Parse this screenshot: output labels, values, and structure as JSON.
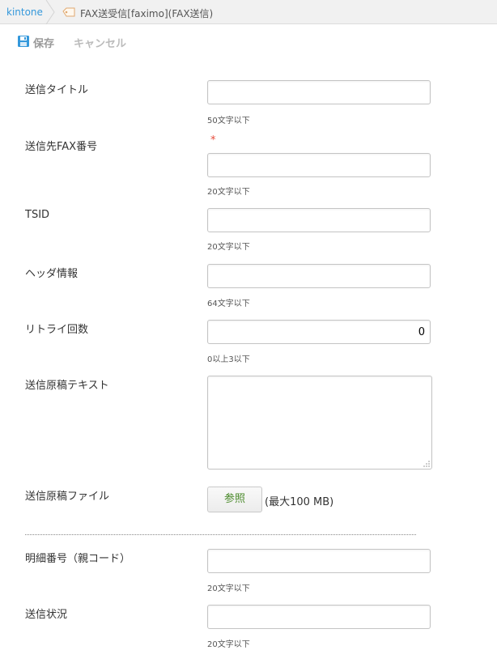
{
  "breadcrumb": {
    "home": "kintone",
    "app": "FAX送受信[faximo](FAX送信)"
  },
  "toolbar": {
    "save_label": "保存",
    "cancel_label": "キャンセル"
  },
  "fields": [
    {
      "label": "送信タイトル",
      "value": "",
      "hint": "50文字以下"
    },
    {
      "label": "送信先FAX番号",
      "value": "",
      "hint": "20文字以下",
      "required_mark": "*"
    },
    {
      "label": "TSID",
      "value": "",
      "hint": "20文字以下"
    },
    {
      "label": "ヘッダ情報",
      "value": "",
      "hint": "64文字以下"
    },
    {
      "label": "リトライ回数",
      "value": "0",
      "hint": "0以上3以下"
    },
    {
      "label": "送信原稿テキスト",
      "value": ""
    },
    {
      "label": "送信原稿ファイル",
      "button": "参照",
      "limit": "(最大100 MB)"
    },
    {
      "label": "明細番号（親コード）",
      "value": "",
      "hint": "20文字以下"
    },
    {
      "label": "送信状況",
      "value": "",
      "hint": "20文字以下"
    }
  ],
  "colors": {
    "link": "#3498db",
    "required": "#e74c3c",
    "save_icon": "#3498db",
    "browse_text": "#4a8a2a"
  }
}
